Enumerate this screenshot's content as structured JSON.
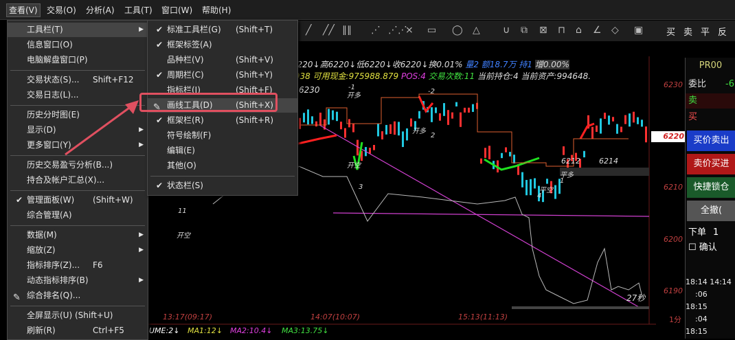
{
  "menubar": {
    "items": [
      "查看(V)",
      "交易(O)",
      "分析(A)",
      "工具(T)",
      "窗口(W)",
      "帮助(H)"
    ]
  },
  "toolbar": {
    "icons": [
      "line-tools",
      "magnet-icon",
      "copy-icon",
      "cross-icon",
      "lock-icon",
      "delete-icon",
      "pen-icon",
      "eraser-icon",
      "save-icon"
    ],
    "buttons": [
      "买",
      "卖",
      "平",
      "反"
    ]
  },
  "view_menu": [
    {
      "label": "工具栏(T)",
      "shortcut": "",
      "submenu": true,
      "highlighted": true
    },
    {
      "label": "信息窗口(O)",
      "shortcut": ""
    },
    {
      "label": "电脑解盘窗口(P)",
      "shortcut": ""
    },
    {
      "separator": true
    },
    {
      "label": "交易状态(S)...",
      "shortcut": "Shift+F12"
    },
    {
      "label": "交易日志(L)...",
      "shortcut": ""
    },
    {
      "separator": true
    },
    {
      "label": "历史分时图(E)",
      "shortcut": ""
    },
    {
      "label": "显示(D)",
      "shortcut": "",
      "submenu": true
    },
    {
      "label": "更多窗口(Y)",
      "shortcut": "",
      "submenu": true
    },
    {
      "separator": true
    },
    {
      "label": "历史交易盈亏分析(B...)",
      "shortcut": ""
    },
    {
      "label": "持合及帐户汇总(X)...",
      "shortcut": ""
    },
    {
      "separator": true
    },
    {
      "label": "管理面板(W)",
      "shortcut": "(Shift+W)",
      "checked": true
    },
    {
      "label": "综合管理(A)",
      "shortcut": ""
    },
    {
      "separator": true
    },
    {
      "label": "数据(M)",
      "shortcut": "",
      "submenu": true
    },
    {
      "label": "缩放(Z)",
      "shortcut": "",
      "submenu": true
    },
    {
      "label": "指标排序(Z)...",
      "shortcut": "F6"
    },
    {
      "label": "动态指标排序(B)",
      "shortcut": "",
      "submenu": true
    },
    {
      "label": "综合排名(Q)...",
      "shortcut": "",
      "icon": true
    },
    {
      "separator": true
    },
    {
      "label": "全屏显示(U) (Shift+U)",
      "shortcut": ""
    },
    {
      "label": "刷新(R)",
      "shortcut": "Ctrl+F5"
    }
  ],
  "toolbar_submenu": [
    {
      "label": "标准工具栏(G)",
      "shortcut": "(Shift+T)",
      "checked": true
    },
    {
      "label": "框架标签(A)",
      "shortcut": "",
      "checked": true
    },
    {
      "label": "品种栏(V)",
      "shortcut": "(Shift+V)"
    },
    {
      "label": "周期栏(C)",
      "shortcut": "(Shift+Y)",
      "checked": true
    },
    {
      "label": "指标栏(I)",
      "shortcut": "(Shift+F)"
    },
    {
      "label": "画线工具(D)",
      "shortcut": "(Shift+X)",
      "icon": true,
      "highlighted": true
    },
    {
      "label": "框架栏(R)",
      "shortcut": "(Shift+R)",
      "checked": true
    },
    {
      "label": "符号绘制(F)",
      "shortcut": ""
    },
    {
      "label": "编辑(E)",
      "shortcut": ""
    },
    {
      "label": "其他(O)",
      "shortcut": ""
    },
    {
      "separator": true
    },
    {
      "label": "状态栏(S)",
      "shortcut": "",
      "checked": true
    }
  ],
  "chart": {
    "info_line1": "6220↓高6220↓低6220↓收6220↓换0.01%",
    "info_line1b": "量2",
    "info_line1c": "额18.7万",
    "info_line1d": "持1",
    "info_line1e": "增0.00%",
    "info_line2a": ".938",
    "info_line2b": "可用现金:975988.879",
    "info_line2c": "POS:4",
    "info_line2d": "交易次数:11",
    "info_line2e": "当前持仓:4 当前资产:994648.",
    "price_labels": [
      "6230",
      "6220",
      "6210",
      "6200",
      "6190"
    ],
    "price_current": "6220",
    "time_labels": [
      "13:17(09:17)",
      "14:07(10:07)",
      "15:13(11:13)"
    ],
    "period": "1分",
    "annot": {
      "high": "6230",
      "l1": "6212",
      "l2": "6214",
      "count": "27秒"
    },
    "bottom": {
      "a": "UME:2↓",
      "b": "MA1:12↓",
      "c": "MA2:10.4↓",
      "d": "MA3:13.75↓"
    },
    "signals": [
      "开空",
      "开多",
      "平空",
      "平多",
      "开空",
      "开多",
      "-1",
      "-2",
      "1",
      "2",
      "3",
      "4",
      "11"
    ]
  },
  "right_panel": {
    "title": "PR00",
    "row_weibi": "委比",
    "row_weibi_val": "-6",
    "row_sell": "卖",
    "row_buy": "买",
    "btn_sell": "买价卖出",
    "btn_buy": "卖价买进",
    "btn_lock": "快捷锁仓",
    "btn_cancel": "全撤(",
    "order_label": "下单",
    "order_qty": "1",
    "confirm": "确认",
    "times": [
      "18:14",
      "14:14",
      ":06",
      "18:15",
      ":04",
      "18:15"
    ]
  },
  "colors": {
    "red": "#ff2020",
    "green": "#20e020",
    "cyan": "#20c8e0",
    "magenta": "#d040d0",
    "yellow": "#e0e040",
    "highlight": "#e05060"
  }
}
